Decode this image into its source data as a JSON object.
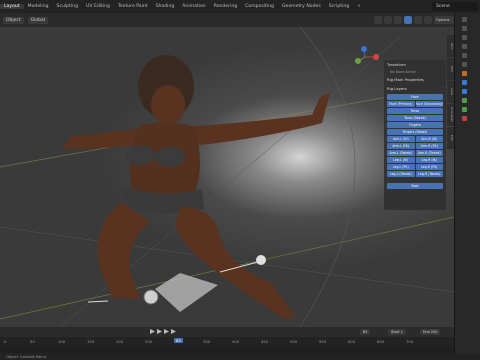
{
  "topbar": {
    "tabs": [
      "Layout",
      "Modeling",
      "Sculpting",
      "UV Editing",
      "Texture Paint",
      "Shading",
      "Animation",
      "Rendering",
      "Compositing",
      "Geometry Nodes",
      "Scripting",
      "+"
    ],
    "active_tab": "Layout",
    "scene_label": "Scene"
  },
  "viewport_header": {
    "mode": "Object",
    "orientation": "Global",
    "options_label": "Options"
  },
  "npanel": {
    "transform": "Transform",
    "no_bone": "No Bone Active",
    "rig_main": "Rig Main Properties",
    "rig_layers": "Rig Layers",
    "buttons": [
      "Face",
      [
        "Face (Primary)",
        "Face (Secondary)"
      ],
      "Torso",
      "Torso (Tweak)",
      "Fingers",
      "Fingers (Detail)",
      [
        "Arm.L (IK)",
        "Arm.R (IK)"
      ],
      [
        "Arm.L (FK)",
        "Arm.R (FK)"
      ],
      [
        "Arm.L (Tweak)",
        "Arm.R (Tweak)"
      ],
      [
        "Leg.L (IK)",
        "Leg.R (IK)"
      ],
      [
        "Leg.L (FK)",
        "Leg.R (FK)"
      ],
      [
        "Leg.L (Tweak)",
        "Leg.R (Tweak)"
      ]
    ],
    "root": "Root"
  },
  "side_tabs": [
    "Item",
    "Tool",
    "View",
    "Animation",
    "Edit"
  ],
  "timeline": {
    "start_label": "Start",
    "start_value": "1",
    "end_label": "End",
    "end_value": "250",
    "current_frame": "83",
    "ticks": [
      "0",
      "50",
      "100",
      "150",
      "200",
      "250",
      "300",
      "350",
      "400",
      "450",
      "500",
      "550",
      "600",
      "650",
      "700"
    ]
  },
  "status": "Object Context Menu",
  "colors": {
    "accent": "#4772b3",
    "skin": "#5a3220"
  }
}
